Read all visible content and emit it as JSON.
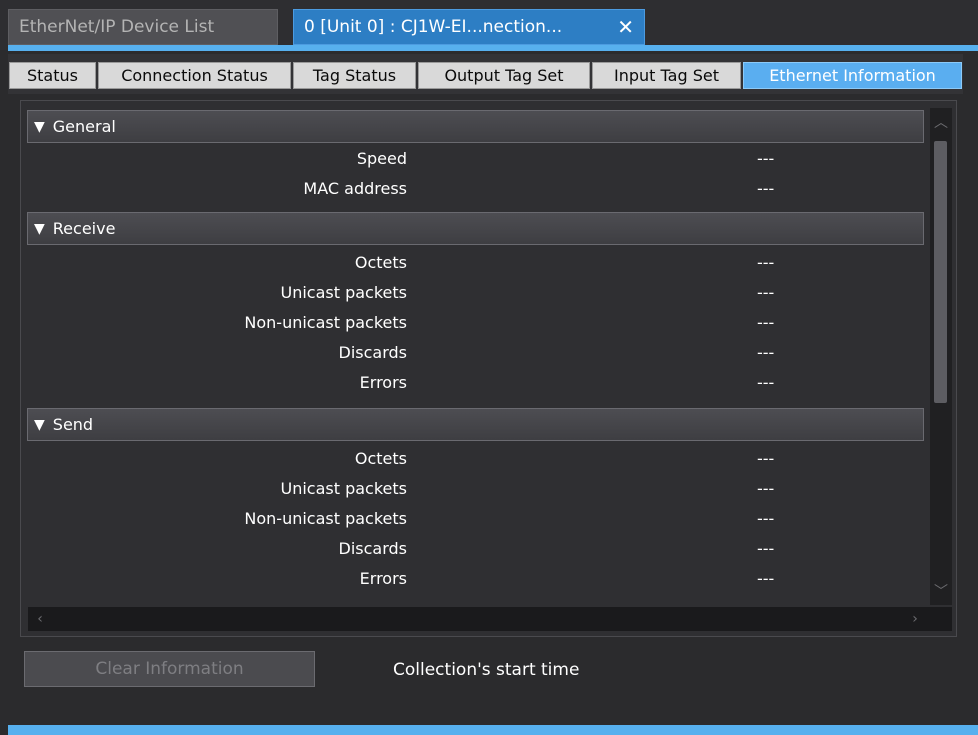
{
  "doc_tabs": {
    "inactive_label": "EtherNet/IP Device List",
    "active_label": "0 [Unit 0] : CJ1W-EI...nection...",
    "close_glyph": "✕"
  },
  "sub_tabs": [
    "Status",
    "Connection Status",
    "Tag Status",
    "Output Tag Set",
    "Input Tag Set",
    "Ethernet Information"
  ],
  "selected_sub_tab": "Ethernet Information",
  "sections": {
    "general": {
      "title": "General",
      "rows": [
        {
          "label": "Speed",
          "value": "---"
        },
        {
          "label": "MAC address",
          "value": "---"
        }
      ]
    },
    "receive": {
      "title": "Receive",
      "rows": [
        {
          "label": "Octets",
          "value": "---"
        },
        {
          "label": "Unicast packets",
          "value": "---"
        },
        {
          "label": "Non-unicast packets",
          "value": "---"
        },
        {
          "label": "Discards",
          "value": "---"
        },
        {
          "label": "Errors",
          "value": "---"
        }
      ]
    },
    "send": {
      "title": "Send",
      "rows": [
        {
          "label": "Octets",
          "value": "---"
        },
        {
          "label": "Unicast packets",
          "value": "---"
        },
        {
          "label": "Non-unicast packets",
          "value": "---"
        },
        {
          "label": "Discards",
          "value": "---"
        },
        {
          "label": "Errors",
          "value": "---"
        }
      ]
    }
  },
  "footer": {
    "clear_button": "Clear Information",
    "collection_label": "Collection's start time"
  },
  "colors": {
    "accent": "#57b0ee",
    "active_tab": "#2d7ec4",
    "selected_sub_tab": "#5aaef0",
    "background": "#2b2b2d"
  },
  "icons": {
    "expand": "triangle-down-icon",
    "close": "close-icon",
    "scroll_up": "chevron-up-icon",
    "scroll_down": "chevron-down-icon",
    "scroll_left": "chevron-left-icon",
    "scroll_right": "chevron-right-icon"
  }
}
